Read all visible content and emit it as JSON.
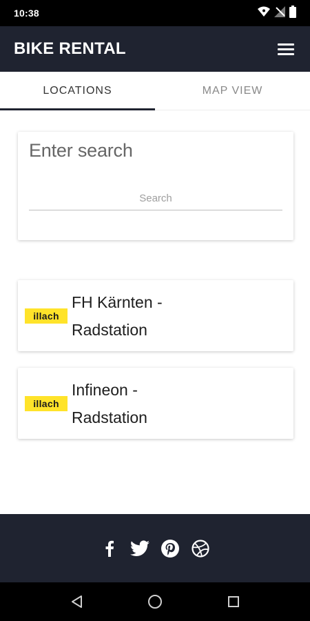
{
  "status_bar": {
    "time": "10:38",
    "icons": [
      "wifi-icon",
      "signal-off-icon",
      "battery-icon"
    ]
  },
  "app_bar": {
    "title": "BIKE RENTAL",
    "menu_icon": "hamburger-menu-icon"
  },
  "tabs": [
    {
      "label": "LOCATIONS",
      "active": true
    },
    {
      "label": "MAP VIEW",
      "active": false
    }
  ],
  "search": {
    "title": "Enter search",
    "placeholder": "Search",
    "value": ""
  },
  "locations": [
    {
      "logo_text": "illach",
      "name_line1": "FH Kärnten -",
      "name_line2": "Radstation"
    },
    {
      "logo_text": "illach",
      "name_line1": "Infineon -",
      "name_line2": "Radstation"
    }
  ],
  "footer": {
    "social_icons": [
      "facebook-icon",
      "twitter-icon",
      "pinterest-icon",
      "dribbble-icon"
    ]
  },
  "nav": {
    "icons": [
      "back-icon",
      "home-icon",
      "recents-icon"
    ]
  },
  "colors": {
    "app_bar": "#1f2330",
    "logo_yellow": "#ffe32a"
  }
}
